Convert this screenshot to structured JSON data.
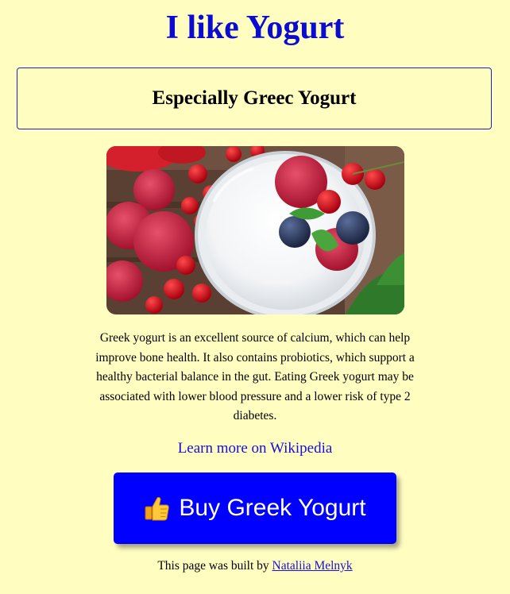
{
  "header": {
    "title": "I like Yogurt",
    "subtitle": "Especially Greec Yogurt"
  },
  "hero_image": {
    "alt": "Glass of Greek yogurt with raspberries, red currants, blueberries and mint"
  },
  "description": "Greek yogurt is an excellent source of calcium, which can help improve bone health. It also contains probiotics, which support a healthy bacterial balance in the gut. Eating Greek yogurt may be associated with lower blood pressure and a lower risk of type 2 diabetes.",
  "wiki_link": {
    "label": "Learn more on Wikipedia"
  },
  "buy_button": {
    "label": "Buy Greek Yogurt",
    "icon": "thumbs-up-icon"
  },
  "footer": {
    "prefix": "This page was built by",
    "author": "Nataliia Melnyk"
  },
  "colors": {
    "background": "#fffdc0",
    "title": "#0b0ccf",
    "button": "#0000ff",
    "link": "#1a0fd6"
  }
}
